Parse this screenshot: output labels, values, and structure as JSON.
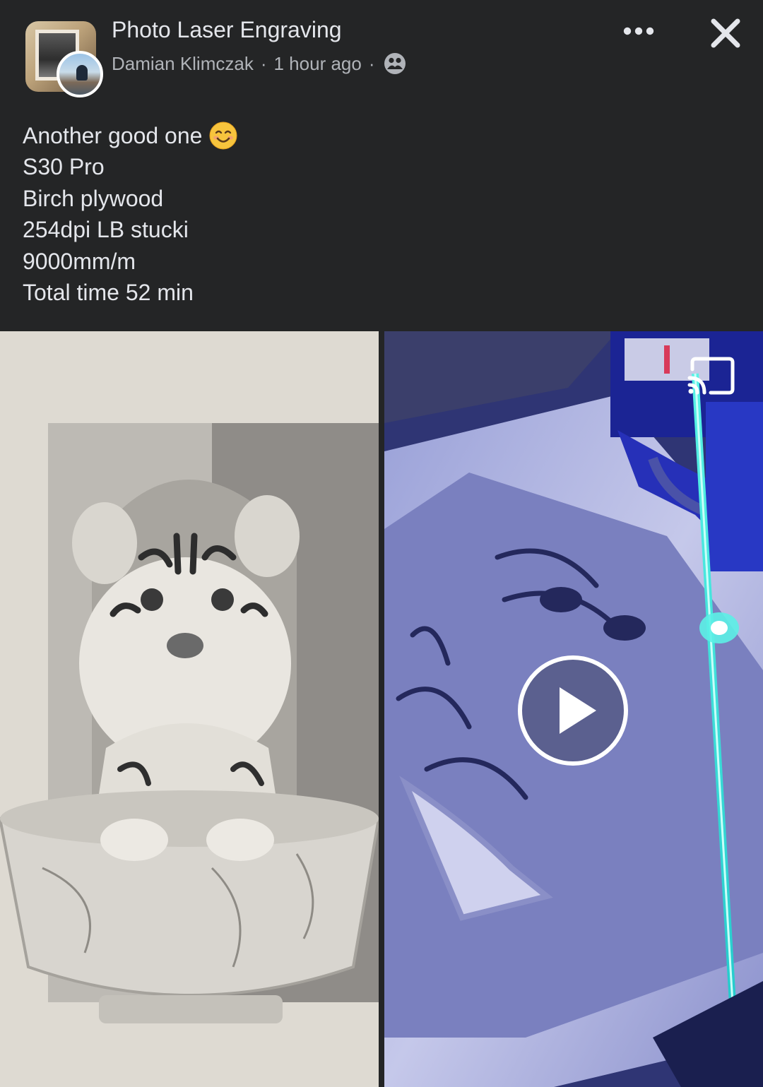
{
  "header": {
    "group_name": "Photo Laser Engraving",
    "author": "Damian Klimczak",
    "separator": "·",
    "time": "1 hour ago",
    "privacy_icon": "group-members-icon",
    "more_icon": "more-options-icon",
    "close_icon": "close-icon"
  },
  "post": {
    "lines": [
      "Another good one",
      "S30 Pro",
      "Birch plywood",
      "254dpi LB stucki",
      "9000mm/m",
      "Total time 52 min"
    ],
    "emoji": "smiling-face-icon"
  },
  "media": {
    "left_photo": "engraved-tiger-cub-photo",
    "right_video": "laser-engraving-video",
    "play_icon": "play-icon",
    "cast_icon": "cast-icon"
  },
  "colors": {
    "background": "#242526",
    "primary_text": "#e4e6eb",
    "secondary_text": "#b0b3b8",
    "laser": "#2fe0d0"
  }
}
